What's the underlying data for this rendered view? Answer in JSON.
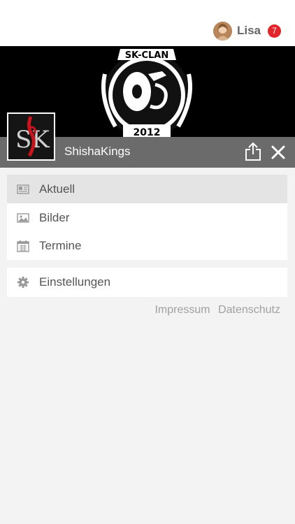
{
  "user": {
    "name": "Lisa",
    "notification_count": "7"
  },
  "banner": {
    "top_text": "SK-CLAN",
    "year": "2012"
  },
  "group": {
    "name": "ShishaKings",
    "thumb_text": "SK"
  },
  "menu": {
    "items": [
      {
        "label": "Aktuell",
        "icon": "newspaper-icon",
        "active": true
      },
      {
        "label": "Bilder",
        "icon": "image-icon",
        "active": false
      },
      {
        "label": "Termine",
        "icon": "calendar-icon",
        "active": false
      }
    ],
    "settings": {
      "label": "Einstellungen",
      "icon": "gear-icon"
    }
  },
  "footer": {
    "impressum": "Impressum",
    "datenschutz": "Datenschutz"
  },
  "colors": {
    "badge": "#e3242b",
    "namebar": "#6b6b6b",
    "active_item": "#e4e4e4"
  }
}
